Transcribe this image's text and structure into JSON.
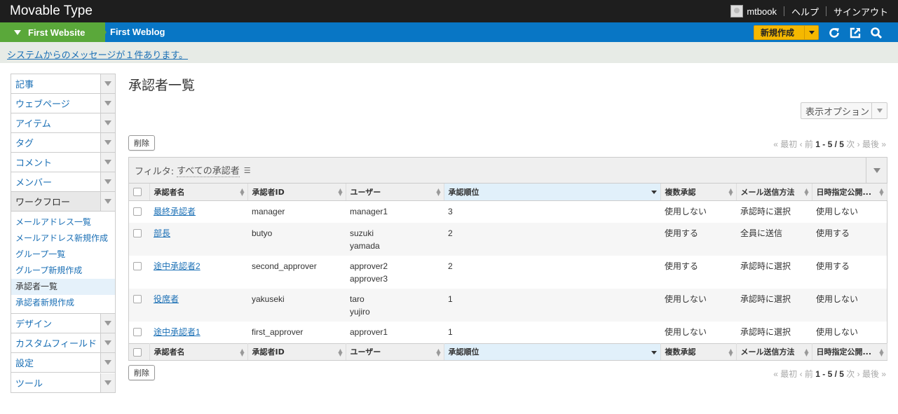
{
  "header": {
    "brand": "Movable Type",
    "user": "mtbook",
    "help": "ヘルプ",
    "signout": "サインアウト"
  },
  "nav": {
    "website": "First Website",
    "blog": "First Weblog",
    "new_label": "新規作成"
  },
  "message": "システムからのメッセージが１件あります。",
  "sidebar": {
    "items": [
      {
        "label": "記事"
      },
      {
        "label": "ウェブページ"
      },
      {
        "label": "アイテム"
      },
      {
        "label": "タグ"
      },
      {
        "label": "コメント"
      },
      {
        "label": "メンバー"
      },
      {
        "label": "ワークフロー"
      }
    ],
    "workflow_sub": [
      {
        "label": "メールアドレス一覧"
      },
      {
        "label": "メールアドレス新規作成"
      },
      {
        "label": "グループ一覧"
      },
      {
        "label": "グループ新規作成"
      },
      {
        "label": "承認者一覧"
      },
      {
        "label": "承認者新規作成"
      }
    ],
    "items_after": [
      {
        "label": "デザイン"
      },
      {
        "label": "カスタムフィールド"
      },
      {
        "label": "設定"
      },
      {
        "label": "ツール"
      }
    ]
  },
  "main": {
    "title": "承認者一覧",
    "display_options": "表示オプション",
    "delete_label": "削除",
    "pager": {
      "first": "« 最初",
      "prev": "‹ 前",
      "range": "1 - 5 / 5",
      "next": "次 ›",
      "last": "最後 »"
    },
    "filter": {
      "label": "フィルタ:",
      "value": "すべての承認者"
    },
    "columns": [
      "承認者名",
      "承認者ID",
      "ユーザー",
      "承認順位",
      "複数承認",
      "メール送信方法",
      "日時指定公開..."
    ],
    "rows": [
      {
        "name": "最終承認者",
        "id": "manager",
        "users": [
          "manager1"
        ],
        "order": "3",
        "multi": "使用しない",
        "mail": "承認時に選択",
        "scheduled": "使用しない"
      },
      {
        "name": "部長",
        "id": "butyo",
        "users": [
          "suzuki",
          "yamada"
        ],
        "order": "2",
        "multi": "使用する",
        "mail": "全員に送信",
        "scheduled": "使用する"
      },
      {
        "name": "途中承認者2",
        "id": "second_approver",
        "users": [
          "approver2",
          "approver3"
        ],
        "order": "2",
        "multi": "使用する",
        "mail": "承認時に選択",
        "scheduled": "使用する"
      },
      {
        "name": "役席者",
        "id": "yakuseki",
        "users": [
          "taro",
          "yujiro"
        ],
        "order": "1",
        "multi": "使用しない",
        "mail": "承認時に選択",
        "scheduled": "使用しない"
      },
      {
        "name": "途中承認者1",
        "id": "first_approver",
        "users": [
          "approver1"
        ],
        "order": "1",
        "multi": "使用しない",
        "mail": "承認時に選択",
        "scheduled": "使用しない"
      }
    ]
  },
  "colors": {
    "topbar": "#1e1e1e",
    "navbar": "#0876c5",
    "website": "#5aa83a",
    "new_button": "#f5b800",
    "link": "#1a6fb5"
  }
}
